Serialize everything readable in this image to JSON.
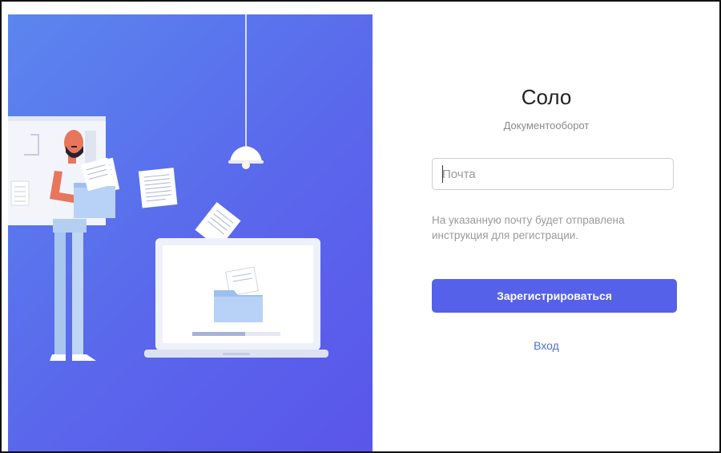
{
  "app": {
    "title": "Соло",
    "subtitle": "Документооборот"
  },
  "form": {
    "email_value": "",
    "email_placeholder": "Почта",
    "hint": "На указанную почту будет отправлена инструкция для регистрации.",
    "register_label": "Зарегистрироваться",
    "login_label": "Вход"
  },
  "colors": {
    "accent": "#5561e8",
    "link": "#4e6fd8",
    "illustration_background": "#5a67ec"
  },
  "illustration": {
    "icons": [
      "person-icon",
      "lamp-icon",
      "laptop-icon",
      "folder-icon",
      "document-icon",
      "whiteboard-icon"
    ]
  }
}
